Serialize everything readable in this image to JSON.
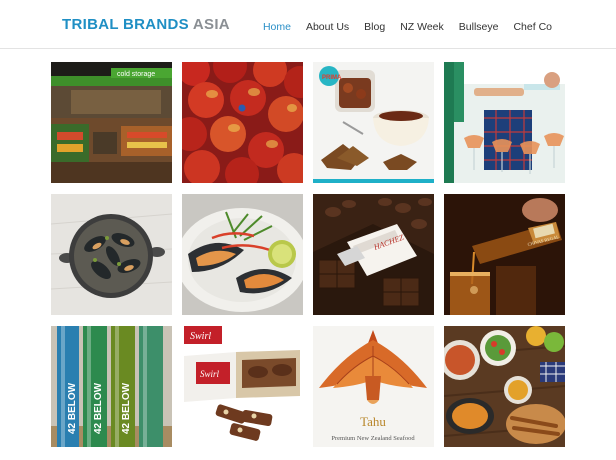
{
  "brand": {
    "part1": "TRIBAL BRANDS",
    "part2": " ASIA"
  },
  "nav": [
    {
      "label": "Home",
      "active": true
    },
    {
      "label": "About Us",
      "active": false
    },
    {
      "label": "Blog",
      "active": false
    },
    {
      "label": "NZ Week",
      "active": false
    },
    {
      "label": "Bullseye",
      "active": false
    },
    {
      "label": "Chef Co",
      "active": false
    }
  ],
  "tiles": {
    "supermarket_sign": "cold storage",
    "jar_badge": "PRIMA",
    "chocolate_box": "HACHEZ",
    "whisky_label": "CHIVAS REGAL",
    "vodka_1": "42 BELOW",
    "vodka_2": "42 BELOW",
    "vodka_3": "42 BELOW",
    "swirl_1": "Swirl",
    "swirl_2": "Swirl",
    "tahu_name": "Tahu",
    "tahu_tagline": "Premium New Zealand Seafood"
  },
  "colors": {
    "brand_blue": "#1f8fc4",
    "brand_grey": "#8a8f94",
    "nav_active": "#2a8fc7"
  }
}
